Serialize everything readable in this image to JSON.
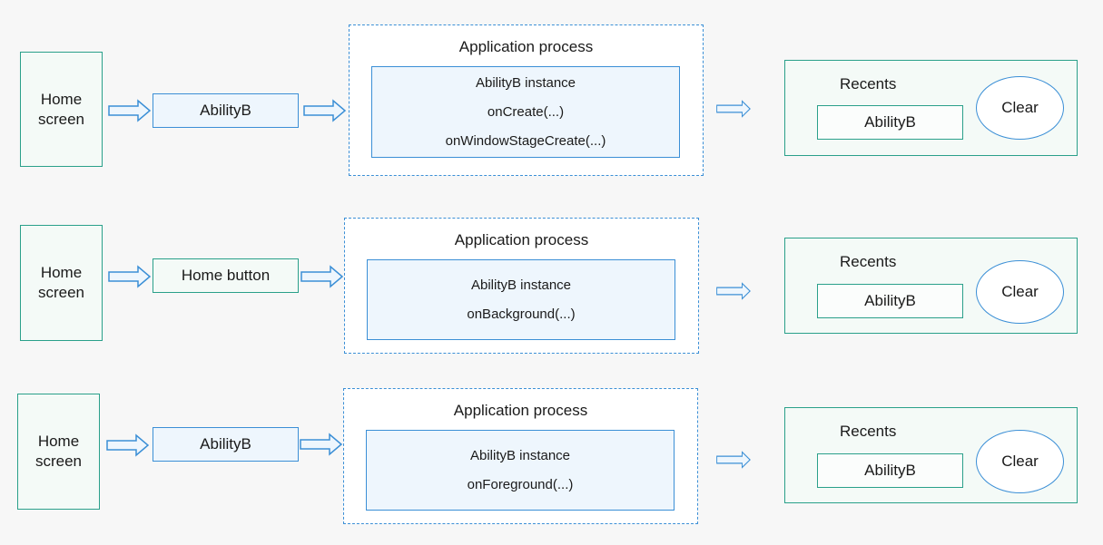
{
  "diagram": {
    "rows": [
      {
        "home_screen": "Home\nscreen",
        "trigger": {
          "label": "AbilityB",
          "style": "blue"
        },
        "process": {
          "title": "Application process",
          "instance_lines": [
            "AbilityB instance",
            "onCreate(...)",
            "onWindowStageCreate(...)"
          ]
        },
        "recents": {
          "title": "Recents",
          "item": "AbilityB",
          "clear": "Clear"
        }
      },
      {
        "home_screen": "Home\nscreen",
        "trigger": {
          "label": "Home button",
          "style": "green"
        },
        "process": {
          "title": "Application process",
          "instance_lines": [
            "AbilityB instance",
            "onBackground(...)"
          ]
        },
        "recents": {
          "title": "Recents",
          "item": "AbilityB",
          "clear": "Clear"
        }
      },
      {
        "home_screen": "Home\nscreen",
        "trigger": {
          "label": "AbilityB",
          "style": "blue"
        },
        "process": {
          "title": "Application process",
          "instance_lines": [
            "AbilityB instance",
            "onForeground(...)"
          ]
        },
        "recents": {
          "title": "Recents",
          "item": "AbilityB",
          "clear": "Clear"
        }
      }
    ],
    "colors": {
      "background": "#f7f7f7",
      "blue_accent": "#3b8fd6",
      "green_accent": "#2aa08a",
      "blue_fill": "#eef6fd",
      "green_fill": "#f4faf7"
    }
  }
}
